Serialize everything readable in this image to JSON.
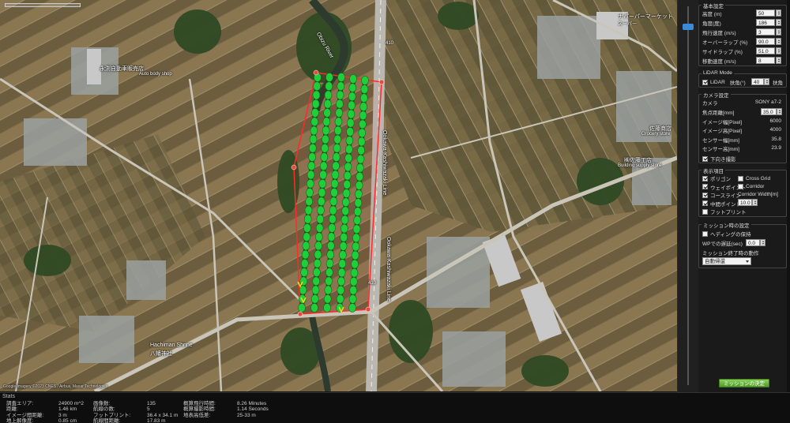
{
  "map": {
    "labels": {
      "river": "Obizu River",
      "route_top": "410",
      "route_bottom": "410",
      "route_vertical": "Ookawa-Kashiwazaki Line",
      "shrine": "Hachiman Shrine",
      "shrine_sub": "八幡神社",
      "poi_top_left": "永渕自動車販売店",
      "poi_top_left_sub": "Auto body shop",
      "poi_top_right": "ナパーパーマーケット",
      "poi_top_right_sub": "スーパー",
      "poi_mid_right": "佐藤商店",
      "poi_mid_right_sub": "Grocery store",
      "poi_right": "㈱佐藤工店",
      "poi_right_sub": "Building supply store",
      "credit": "Google  Imagery ©2023 CNES / Airbus, Maxar Technologies"
    },
    "flight_area_color": "#ff2a2a",
    "waypoint_color": "#1fcf3a",
    "marker_color": "#e84a3a"
  },
  "panel": {
    "basic": {
      "title": "基本設定",
      "fields": [
        {
          "label": "高度 (m)",
          "value": "50"
        },
        {
          "label": "角度(度)",
          "value": "186"
        },
        {
          "label": "飛行速度 (m/s)",
          "value": "3"
        },
        {
          "label": "オーバーラップ (%)",
          "value": "90.0"
        },
        {
          "label": "サイドラップ (%)",
          "value": "51.0"
        },
        {
          "label": "移動速度 (m/s)",
          "value": "8"
        }
      ]
    },
    "lidar": {
      "title": "LiDAR Mode",
      "checkbox_label": "LiDAR",
      "angle_label": "扶角(°)",
      "angle_value": "40",
      "suffix": "扶角"
    },
    "camera": {
      "title": "カメラ設定",
      "camera_label": "カメラ",
      "camera_value": "SONY a7-2",
      "fields": [
        {
          "label": "焦点距離[mm]",
          "value": "35.0",
          "editable": true
        },
        {
          "label": "イメージ幅[Pixel]",
          "value": "6000",
          "editable": false
        },
        {
          "label": "イメージ高[Pixel]",
          "value": "4000",
          "editable": false
        },
        {
          "label": "センサー幅[mm]",
          "value": "35.8",
          "editable": false
        },
        {
          "label": "センサー高[mm]",
          "value": "23.9",
          "editable": false
        }
      ],
      "nadir_label": "下向き撮影"
    },
    "display": {
      "title": "表示項目",
      "left": [
        {
          "label": "ポリゴン",
          "checked": true
        },
        {
          "label": "ウェイポイント",
          "checked": true
        },
        {
          "label": "コースライン",
          "checked": true
        },
        {
          "label": "中間ポイント",
          "checked": true
        },
        {
          "label": "フットプリント",
          "checked": false
        }
      ],
      "right": [
        {
          "label": "Cross Grid",
          "checked": false
        },
        {
          "label": "Corridor",
          "checked": false
        }
      ],
      "corridor_width_label": "Corridor Width[m]",
      "corridor_width_value": "10.0"
    },
    "mission_settings": {
      "title": "ミッション時の設定",
      "heading_label": "ヘディングの保持",
      "wp_delay_label": "WPでの遅延(sec)",
      "wp_delay_value": "0.0",
      "end_action_label": "ミッション終了時の動作",
      "end_action_value": "自動帰還"
    },
    "confirm_button": "ミッションの決定"
  },
  "stats": {
    "title": "Stats",
    "col1_labels": [
      "調査エリア:",
      "距離:",
      "イメージ間距離:",
      "地上解像度:"
    ],
    "col1_values": [
      "24900 m^2",
      "1.46 km",
      "3 m",
      "0.85 cm"
    ],
    "col2_labels": [
      "画像数:",
      "航線の数:",
      "フットプリント:",
      "航線間距離:"
    ],
    "col2_values": [
      "135",
      "5",
      "36.4 x 34.1 m",
      "17.83 m"
    ],
    "col3_labels": [
      "概算飛行時間:",
      "概算撮影時間:",
      "地表高低差:"
    ],
    "col3_values": [
      "8.26 Minutes",
      "1.14 Seconds",
      "25-33 m"
    ]
  }
}
